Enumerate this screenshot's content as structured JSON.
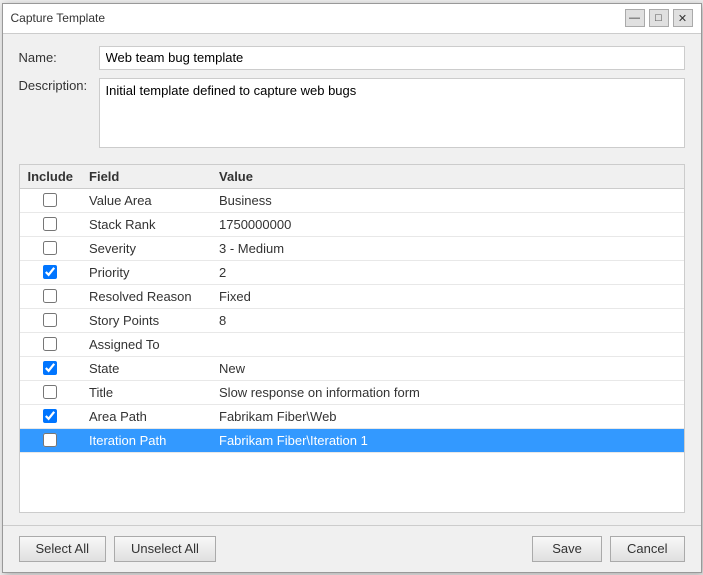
{
  "window": {
    "title": "Capture Template",
    "minimize_label": "—",
    "restore_label": "□",
    "close_label": "✕"
  },
  "form": {
    "name_label": "Name:",
    "name_value": "Web team bug template",
    "description_label": "Description:",
    "description_value": "Initial template defined to capture web bugs"
  },
  "table": {
    "headers": {
      "include": "Include",
      "field": "Field",
      "value": "Value"
    },
    "rows": [
      {
        "checked": false,
        "field": "Value Area",
        "value": "Business",
        "selected": false
      },
      {
        "checked": false,
        "field": "Stack Rank",
        "value": "1750000000",
        "selected": false
      },
      {
        "checked": false,
        "field": "Severity",
        "value": "3 - Medium",
        "selected": false
      },
      {
        "checked": true,
        "field": "Priority",
        "value": "2",
        "selected": false
      },
      {
        "checked": false,
        "field": "Resolved Reason",
        "value": "Fixed",
        "selected": false
      },
      {
        "checked": false,
        "field": "Story Points",
        "value": "8",
        "selected": false
      },
      {
        "checked": false,
        "field": "Assigned To",
        "value": "",
        "selected": false
      },
      {
        "checked": true,
        "field": "State",
        "value": "New",
        "selected": false
      },
      {
        "checked": false,
        "field": "Title",
        "value": "Slow response on information form",
        "selected": false
      },
      {
        "checked": true,
        "field": "Area Path",
        "value": "Fabrikam Fiber\\Web",
        "selected": false
      },
      {
        "checked": false,
        "field": "Iteration Path",
        "value": "Fabrikam Fiber\\Iteration 1",
        "selected": true
      }
    ]
  },
  "footer": {
    "select_all_label": "Select All",
    "unselect_all_label": "Unselect All",
    "save_label": "Save",
    "cancel_label": "Cancel"
  }
}
